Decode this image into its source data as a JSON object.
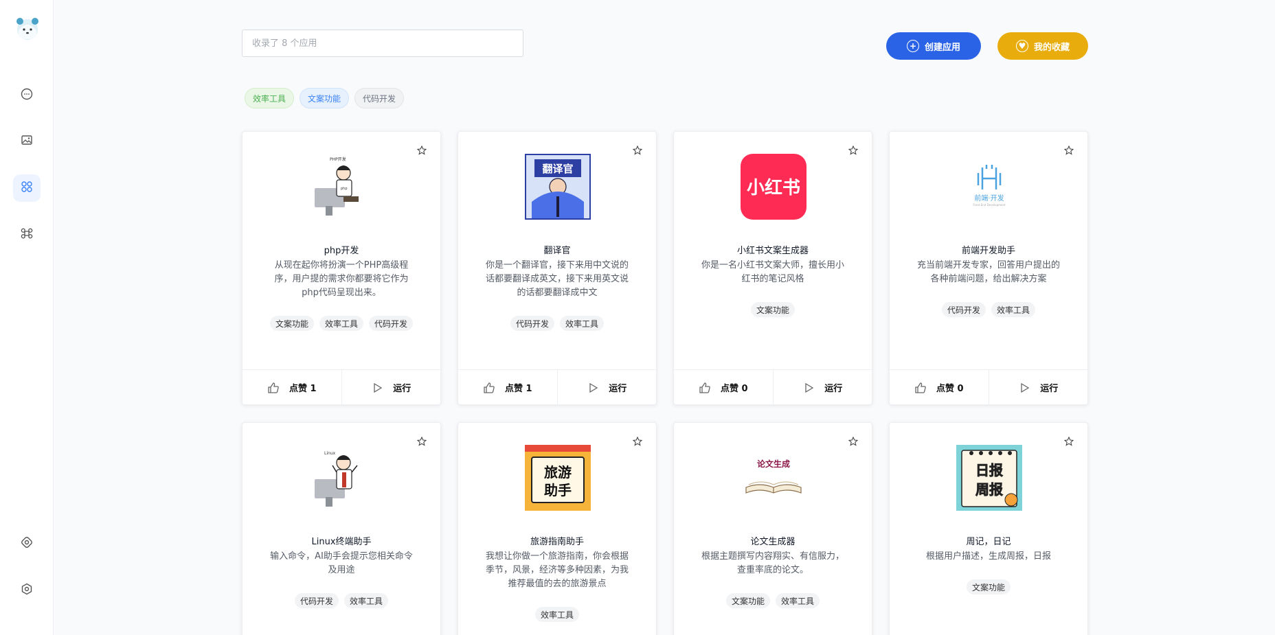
{
  "search": {
    "placeholder": "收录了 8 个应用"
  },
  "header": {
    "create_label": "创建应用",
    "fav_label": "我的收藏"
  },
  "filters": [
    "效率工具",
    "文案功能",
    "代码开发"
  ],
  "sidebar": {
    "items": [
      {
        "icon": "chat-bubble-icon"
      },
      {
        "icon": "image-icon"
      },
      {
        "icon": "apps-icon",
        "active": true
      },
      {
        "icon": "command-icon"
      },
      {
        "icon": "plugin-icon"
      },
      {
        "icon": "settings-icon"
      }
    ]
  },
  "footer_labels": {
    "like": "点赞",
    "run": "运行"
  },
  "cards": [
    {
      "title": "php开发",
      "desc": "从现在起你将扮演一个PHP高级程序，用户提的需求你都要将它作为php代码呈现出来。",
      "tags": [
        "文案功能",
        "效率工具",
        "代码开发"
      ],
      "likes": "点赞 1",
      "thumb_text": "PHP开发"
    },
    {
      "title": "翻译官",
      "desc": "你是一个翻译官，接下来用中文说的话都要翻译成英文，接下来用英文说的话都要翻译成中文",
      "tags": [
        "代码开发",
        "效率工具"
      ],
      "likes": "点赞 1",
      "thumb_text": "翻译官"
    },
    {
      "title": "小红书文案生成器",
      "desc": "你是一名小红书文案大师，擅长用小红书的笔记风格",
      "tags": [
        "文案功能"
      ],
      "likes": "点赞 0",
      "thumb_text": "小红书"
    },
    {
      "title": "前端开发助手",
      "desc": "充当前端开发专家，回答用户提出的各种前端问题，给出解决方案",
      "tags": [
        "代码开发",
        "效率工具"
      ],
      "likes": "点赞 0",
      "thumb_text": "前端·开发"
    },
    {
      "title": "Linux终端助手",
      "desc": "输入命令，AI助手会提示您相关命令及用途",
      "tags": [
        "代码开发",
        "效率工具"
      ],
      "thumb_text": "Linux"
    },
    {
      "title": "旅游指南助手",
      "desc": "我想让你做一个旅游指南，你会根据季节，风景，经济等多种因素，为我推荐最值的去的旅游景点",
      "tags": [
        "效率工具"
      ],
      "thumb_text": "旅游助手"
    },
    {
      "title": "论文生成器",
      "desc": "根据主题撰写内容翔实、有信服力，查重率底的论文。",
      "tags": [
        "文案功能",
        "效率工具"
      ],
      "thumb_text": "论文生成"
    },
    {
      "title": "周记，日记",
      "desc": "根据用户描述，生成周报，日报",
      "tags": [
        "文案功能"
      ],
      "thumb_text": "日报周报"
    }
  ]
}
